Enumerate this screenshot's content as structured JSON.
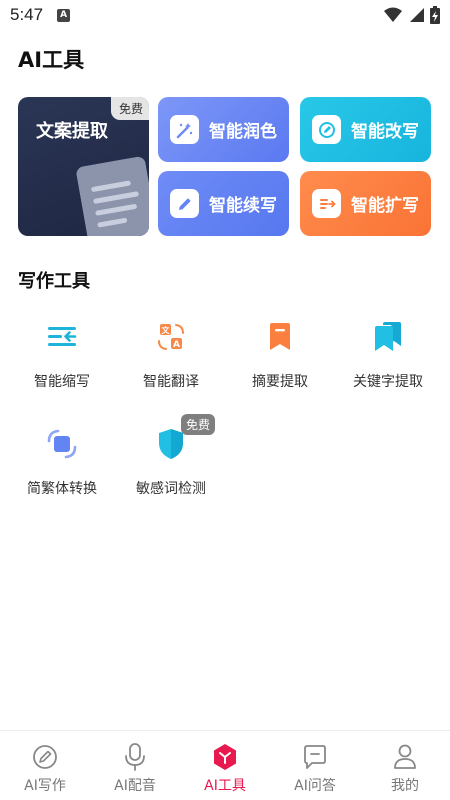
{
  "status_bar": {
    "time": "5:47",
    "notification_icon": "a-icon",
    "right_icons": [
      "wifi-icon",
      "signal-icon",
      "battery-charging-icon"
    ]
  },
  "page": {
    "title": "AI工具"
  },
  "ai_tools": {
    "big_card": {
      "label": "文案提取",
      "badge": "免费",
      "icon": "document-icon"
    },
    "cards": [
      {
        "label": "智能润色",
        "icon": "magic-wand-icon",
        "color": "#6e8af5"
      },
      {
        "label": "智能改写",
        "icon": "edit-circle-icon",
        "color": "#22bfe4"
      },
      {
        "label": "智能续写",
        "icon": "pencil-icon",
        "color": "#6384f3"
      },
      {
        "label": "智能扩写",
        "icon": "expand-text-icon",
        "color": "#fb7f3f"
      }
    ]
  },
  "writing_tools": {
    "title": "写作工具",
    "items": [
      {
        "label": "智能缩写",
        "icon": "shorten-icon"
      },
      {
        "label": "智能翻译",
        "icon": "translate-icon"
      },
      {
        "label": "摘要提取",
        "icon": "bookmark-icon"
      },
      {
        "label": "关键字提取",
        "icon": "bookmarks-icon"
      },
      {
        "label": "简繁体转换",
        "icon": "convert-icon"
      },
      {
        "label": "敏感词检测",
        "icon": "shield-icon",
        "badge": "免费"
      }
    ]
  },
  "bottom_nav": {
    "active_index": 2,
    "accent_color": "#e8194f",
    "items": [
      {
        "label": "AI写作",
        "icon": "pen-icon"
      },
      {
        "label": "AI配音",
        "icon": "microphone-icon"
      },
      {
        "label": "AI工具",
        "icon": "ai-tools-icon"
      },
      {
        "label": "AI问答",
        "icon": "chat-icon"
      },
      {
        "label": "我的",
        "icon": "user-icon"
      }
    ]
  }
}
